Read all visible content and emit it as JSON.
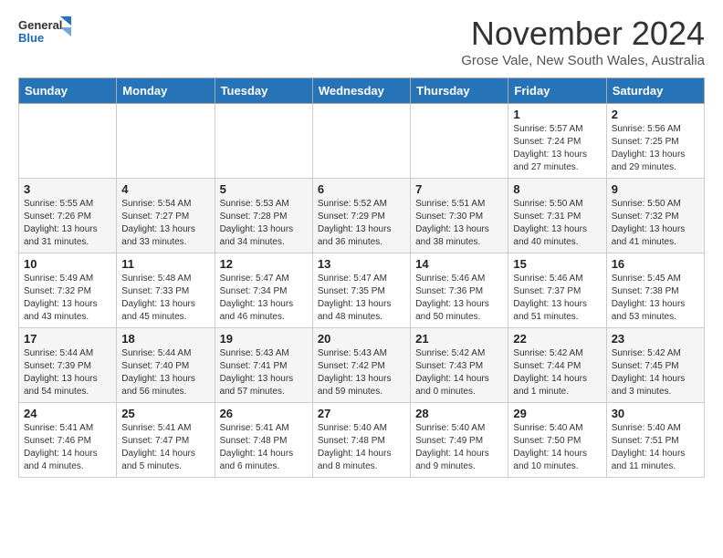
{
  "header": {
    "logo_general": "General",
    "logo_blue": "Blue",
    "month_title": "November 2024",
    "location": "Grose Vale, New South Wales, Australia"
  },
  "days_of_week": [
    "Sunday",
    "Monday",
    "Tuesday",
    "Wednesday",
    "Thursday",
    "Friday",
    "Saturday"
  ],
  "weeks": [
    [
      {
        "day": "",
        "info": ""
      },
      {
        "day": "",
        "info": ""
      },
      {
        "day": "",
        "info": ""
      },
      {
        "day": "",
        "info": ""
      },
      {
        "day": "",
        "info": ""
      },
      {
        "day": "1",
        "info": "Sunrise: 5:57 AM\nSunset: 7:24 PM\nDaylight: 13 hours\nand 27 minutes."
      },
      {
        "day": "2",
        "info": "Sunrise: 5:56 AM\nSunset: 7:25 PM\nDaylight: 13 hours\nand 29 minutes."
      }
    ],
    [
      {
        "day": "3",
        "info": "Sunrise: 5:55 AM\nSunset: 7:26 PM\nDaylight: 13 hours\nand 31 minutes."
      },
      {
        "day": "4",
        "info": "Sunrise: 5:54 AM\nSunset: 7:27 PM\nDaylight: 13 hours\nand 33 minutes."
      },
      {
        "day": "5",
        "info": "Sunrise: 5:53 AM\nSunset: 7:28 PM\nDaylight: 13 hours\nand 34 minutes."
      },
      {
        "day": "6",
        "info": "Sunrise: 5:52 AM\nSunset: 7:29 PM\nDaylight: 13 hours\nand 36 minutes."
      },
      {
        "day": "7",
        "info": "Sunrise: 5:51 AM\nSunset: 7:30 PM\nDaylight: 13 hours\nand 38 minutes."
      },
      {
        "day": "8",
        "info": "Sunrise: 5:50 AM\nSunset: 7:31 PM\nDaylight: 13 hours\nand 40 minutes."
      },
      {
        "day": "9",
        "info": "Sunrise: 5:50 AM\nSunset: 7:32 PM\nDaylight: 13 hours\nand 41 minutes."
      }
    ],
    [
      {
        "day": "10",
        "info": "Sunrise: 5:49 AM\nSunset: 7:32 PM\nDaylight: 13 hours\nand 43 minutes."
      },
      {
        "day": "11",
        "info": "Sunrise: 5:48 AM\nSunset: 7:33 PM\nDaylight: 13 hours\nand 45 minutes."
      },
      {
        "day": "12",
        "info": "Sunrise: 5:47 AM\nSunset: 7:34 PM\nDaylight: 13 hours\nand 46 minutes."
      },
      {
        "day": "13",
        "info": "Sunrise: 5:47 AM\nSunset: 7:35 PM\nDaylight: 13 hours\nand 48 minutes."
      },
      {
        "day": "14",
        "info": "Sunrise: 5:46 AM\nSunset: 7:36 PM\nDaylight: 13 hours\nand 50 minutes."
      },
      {
        "day": "15",
        "info": "Sunrise: 5:46 AM\nSunset: 7:37 PM\nDaylight: 13 hours\nand 51 minutes."
      },
      {
        "day": "16",
        "info": "Sunrise: 5:45 AM\nSunset: 7:38 PM\nDaylight: 13 hours\nand 53 minutes."
      }
    ],
    [
      {
        "day": "17",
        "info": "Sunrise: 5:44 AM\nSunset: 7:39 PM\nDaylight: 13 hours\nand 54 minutes."
      },
      {
        "day": "18",
        "info": "Sunrise: 5:44 AM\nSunset: 7:40 PM\nDaylight: 13 hours\nand 56 minutes."
      },
      {
        "day": "19",
        "info": "Sunrise: 5:43 AM\nSunset: 7:41 PM\nDaylight: 13 hours\nand 57 minutes."
      },
      {
        "day": "20",
        "info": "Sunrise: 5:43 AM\nSunset: 7:42 PM\nDaylight: 13 hours\nand 59 minutes."
      },
      {
        "day": "21",
        "info": "Sunrise: 5:42 AM\nSunset: 7:43 PM\nDaylight: 14 hours\nand 0 minutes."
      },
      {
        "day": "22",
        "info": "Sunrise: 5:42 AM\nSunset: 7:44 PM\nDaylight: 14 hours\nand 1 minute."
      },
      {
        "day": "23",
        "info": "Sunrise: 5:42 AM\nSunset: 7:45 PM\nDaylight: 14 hours\nand 3 minutes."
      }
    ],
    [
      {
        "day": "24",
        "info": "Sunrise: 5:41 AM\nSunset: 7:46 PM\nDaylight: 14 hours\nand 4 minutes."
      },
      {
        "day": "25",
        "info": "Sunrise: 5:41 AM\nSunset: 7:47 PM\nDaylight: 14 hours\nand 5 minutes."
      },
      {
        "day": "26",
        "info": "Sunrise: 5:41 AM\nSunset: 7:48 PM\nDaylight: 14 hours\nand 6 minutes."
      },
      {
        "day": "27",
        "info": "Sunrise: 5:40 AM\nSunset: 7:48 PM\nDaylight: 14 hours\nand 8 minutes."
      },
      {
        "day": "28",
        "info": "Sunrise: 5:40 AM\nSunset: 7:49 PM\nDaylight: 14 hours\nand 9 minutes."
      },
      {
        "day": "29",
        "info": "Sunrise: 5:40 AM\nSunset: 7:50 PM\nDaylight: 14 hours\nand 10 minutes."
      },
      {
        "day": "30",
        "info": "Sunrise: 5:40 AM\nSunset: 7:51 PM\nDaylight: 14 hours\nand 11 minutes."
      }
    ]
  ]
}
